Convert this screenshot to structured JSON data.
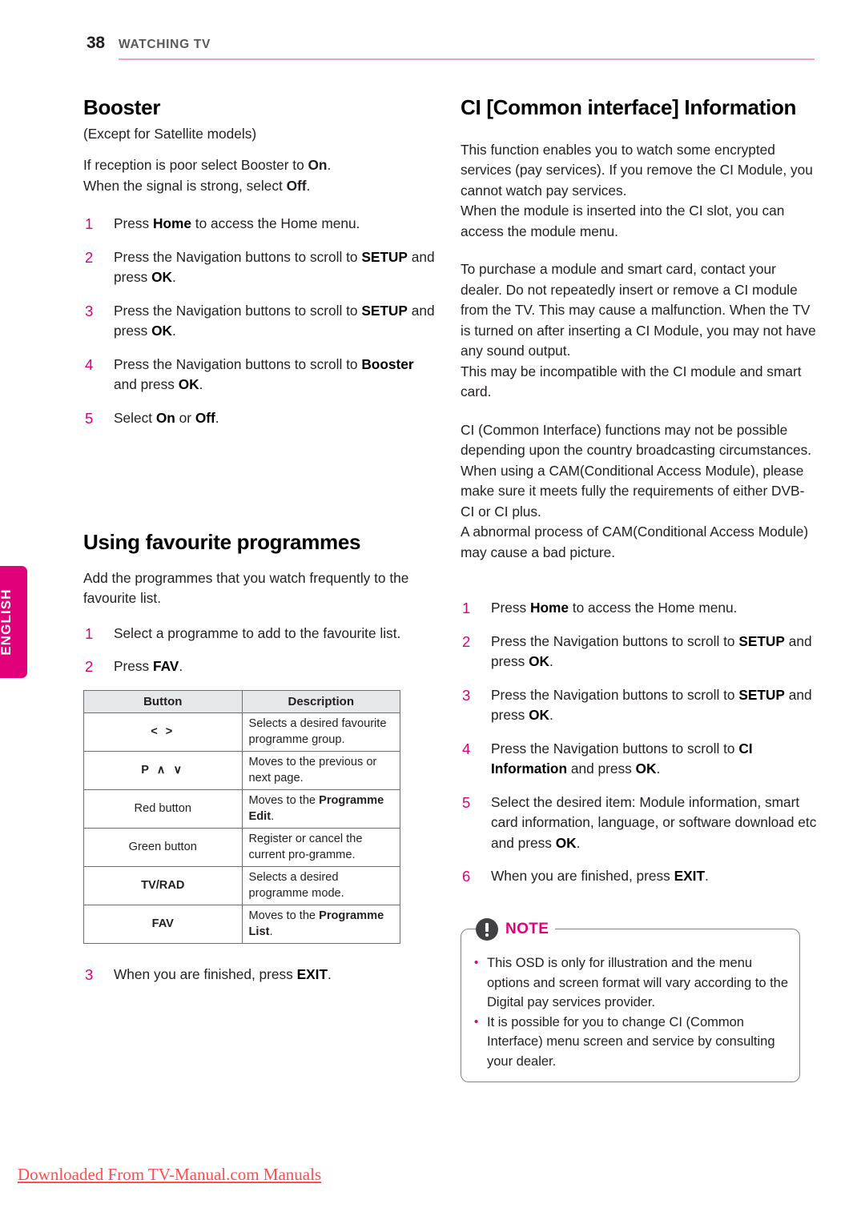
{
  "page": {
    "number": "38",
    "section_title": "WATCHING TV",
    "language_tab": "ENGLISH",
    "accent_color": "#e1007a",
    "rule_color": "#f09ec7"
  },
  "left_column": {
    "booster": {
      "heading": "Booster",
      "subnote": "(Except for Satellite models)",
      "intro_line_1": "If reception is poor select Booster to ",
      "intro_bold_1": "On",
      "intro_line_1_end": ".",
      "intro_line_2": "When the signal is strong, select ",
      "intro_bold_2": "Off",
      "intro_line_2_end": ".",
      "steps": [
        {
          "num": "1",
          "pre": "Press ",
          "b1": "Home",
          "mid": " to access the Home menu.",
          "b2": "",
          "post": ""
        },
        {
          "num": "2",
          "pre": "Press the Navigation buttons to scroll to ",
          "b1": "SETUP",
          "mid": " and press ",
          "b2": "OK",
          "post": "."
        },
        {
          "num": "3",
          "pre": "Press the Navigation buttons to scroll to ",
          "b1": "SETUP",
          "mid": " and press ",
          "b2": "OK",
          "post": "."
        },
        {
          "num": "4",
          "pre": "Press the Navigation buttons to scroll to ",
          "b1": "Booster",
          "mid": " and press ",
          "b2": "OK",
          "post": "."
        },
        {
          "num": "5",
          "pre": "Select ",
          "b1": "On",
          "mid": " or ",
          "b2": "Off",
          "post": "."
        }
      ]
    },
    "favourite": {
      "heading": "Using favourite programmes",
      "intro": "Add the programmes that you watch frequently to the favourite list.",
      "steps": [
        {
          "num": "1",
          "pre": "Select a programme to add to the favourite list.",
          "b1": "",
          "mid": "",
          "b2": "",
          "post": ""
        },
        {
          "num": "2",
          "pre": "Press ",
          "b1": "FAV",
          "mid": ".",
          "b2": "",
          "post": ""
        }
      ],
      "table": {
        "headers": [
          "Button",
          "Description"
        ],
        "rows": [
          {
            "button": "< >",
            "button_bold": false,
            "desc_pre": "Selects a desired favourite programme group.",
            "desc_bold": "",
            "desc_post": ""
          },
          {
            "button": "P ∧ ∨",
            "button_bold": true,
            "desc_pre": "Moves to the previous or next page.",
            "desc_bold": "",
            "desc_post": ""
          },
          {
            "button": "Red button",
            "button_bold": false,
            "desc_pre": "Moves to the ",
            "desc_bold": "Programme Edit",
            "desc_post": "."
          },
          {
            "button": "Green button",
            "button_bold": false,
            "desc_pre": "Register or cancel the current pro-gramme.",
            "desc_bold": "",
            "desc_post": ""
          },
          {
            "button": "TV/RAD",
            "button_bold": true,
            "desc_pre": "Selects a desired programme mode.",
            "desc_bold": "",
            "desc_post": ""
          },
          {
            "button": "FAV",
            "button_bold": true,
            "desc_pre": "Moves to the ",
            "desc_bold": "Programme List",
            "desc_post": "."
          }
        ]
      },
      "final_step": {
        "num": "3",
        "pre": "When you are finished, press ",
        "b1": "EXIT",
        "mid": ".",
        "b2": "",
        "post": ""
      }
    }
  },
  "right_column": {
    "heading": "CI [Common interface] Information",
    "paragraphs": [
      "This function enables you to watch some encrypted services (pay services). If you remove the CI Module, you cannot watch pay services.",
      "When the module is inserted into the CI slot, you can access the module menu.",
      "To purchase a module and smart card, contact your dealer. Do not repeatedly insert or remove a CI module from the TV. This may cause a malfunction. When the TV is turned on after inserting a CI Module, you may not have any sound output.",
      "This may be incompatible with the CI module and smart card.",
      "CI (Common Interface) functions may not be possible depending upon the country broadcasting circumstances.",
      "When using a CAM(Conditional Access Module), please make sure it meets fully the requirements of either DVB-CI or CI plus.",
      "A abnormal process of CAM(Conditional Access Module) may cause a bad picture."
    ],
    "steps": [
      {
        "num": "1",
        "pre": "Press ",
        "b1": "Home",
        "mid": " to access the Home menu.",
        "b2": "",
        "post": ""
      },
      {
        "num": "2",
        "pre": "Press the Navigation buttons to scroll to ",
        "b1": "SETUP",
        "mid": " and press ",
        "b2": "OK",
        "post": "."
      },
      {
        "num": "3",
        "pre": "Press the Navigation buttons to scroll to ",
        "b1": "SETUP",
        "mid": " and press ",
        "b2": "OK",
        "post": "."
      },
      {
        "num": "4",
        "pre": "Press the Navigation buttons to scroll to ",
        "b1": "CI Information",
        "mid": " and press ",
        "b2": "OK",
        "post": "."
      },
      {
        "num": "5",
        "pre": "Select the desired item: Module information, smart card information, language, or software download etc and press ",
        "b1": "OK",
        "mid": ".",
        "b2": "",
        "post": ""
      },
      {
        "num": "6",
        "pre": "When you are finished, press ",
        "b1": "EXIT",
        "mid": ".",
        "b2": "",
        "post": ""
      }
    ],
    "note": {
      "title": "NOTE",
      "icon": "exclamation-circle-icon",
      "items": [
        "This OSD is only for illustration and the menu options and screen format will vary according to the Digital pay services provider.",
        "It is possible for you to change CI (Common Interface) menu screen and service by consulting your dealer."
      ]
    }
  },
  "footer": {
    "link_text": "Downloaded From TV-Manual.com Manuals"
  }
}
